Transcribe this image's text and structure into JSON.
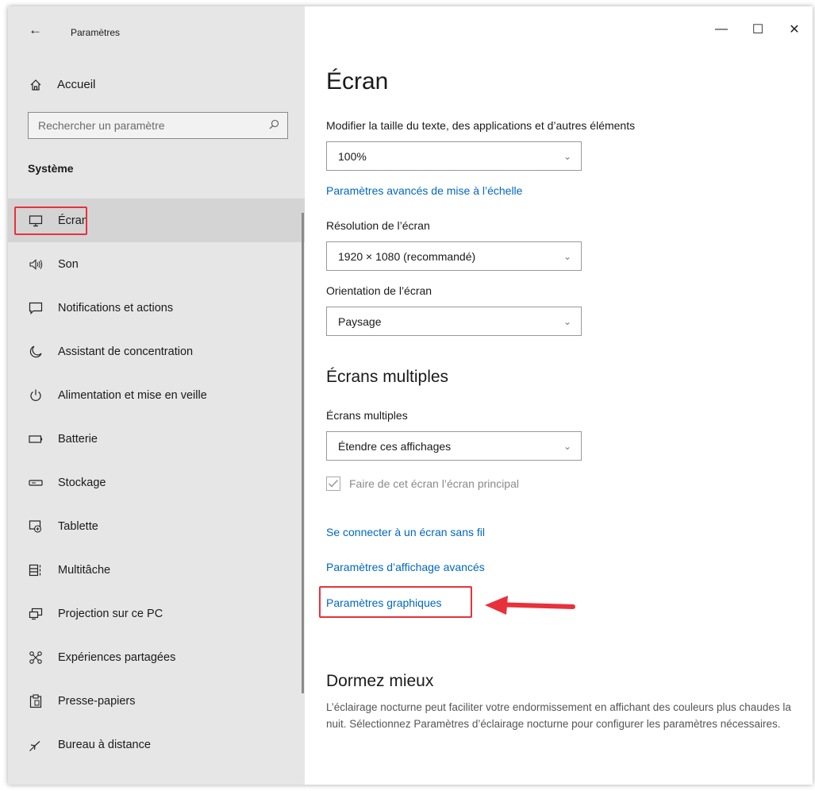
{
  "window": {
    "title": "Paramètres",
    "controls": [
      "minimize-icon",
      "maximize-icon",
      "close-icon"
    ]
  },
  "sidebar": {
    "home_label": "Accueil",
    "search_placeholder": "Rechercher un paramètre",
    "section_title": "Système",
    "items": [
      {
        "label": "Écran",
        "icon": "monitor-icon",
        "active": true
      },
      {
        "label": "Son",
        "icon": "speaker-icon"
      },
      {
        "label": "Notifications et actions",
        "icon": "message-icon"
      },
      {
        "label": "Assistant de concentration",
        "icon": "moon-icon"
      },
      {
        "label": "Alimentation et mise en veille",
        "icon": "power-icon"
      },
      {
        "label": "Batterie",
        "icon": "battery-icon"
      },
      {
        "label": "Stockage",
        "icon": "storage-icon"
      },
      {
        "label": "Tablette",
        "icon": "tablet-icon"
      },
      {
        "label": "Multitâche",
        "icon": "multitask-icon"
      },
      {
        "label": "Projection sur ce PC",
        "icon": "projection-icon"
      },
      {
        "label": "Expériences partagées",
        "icon": "share-icon"
      },
      {
        "label": "Presse-papiers",
        "icon": "clipboard-icon"
      },
      {
        "label": "Bureau à distance",
        "icon": "remote-icon"
      }
    ]
  },
  "main": {
    "title": "Écran",
    "scale_label": "Modifier la taille du texte, des applications et d’autres éléments",
    "scale_value": "100%",
    "advanced_scale_link": "Paramètres avancés de mise à l’échelle",
    "resolution_label": "Résolution de l’écran",
    "resolution_value": "1920 × 1080 (recommandé)",
    "orientation_label": "Orientation de l’écran",
    "orientation_value": "Paysage",
    "multi_heading": "Écrans multiples",
    "multi_label": "Écrans multiples",
    "multi_value": "Étendre ces affichages",
    "main_display_checkbox": "Faire de cet écran l’écran principal",
    "wireless_link": "Se connecter à un écran sans fil",
    "advanced_display_link": "Paramètres d’affichage avancés",
    "graphics_link": "Paramètres graphiques",
    "sleep_heading": "Dormez mieux",
    "sleep_text": "L’éclairage nocturne peut faciliter votre endormissement en affichant des couleurs plus chaudes la nuit. Sélectionnez Paramètres d’éclairage nocturne pour configurer les paramètres nécessaires."
  },
  "colors": {
    "accent": "#0067c0",
    "highlight": "#e8313b",
    "sidebar_bg": "#e6e6e6"
  }
}
